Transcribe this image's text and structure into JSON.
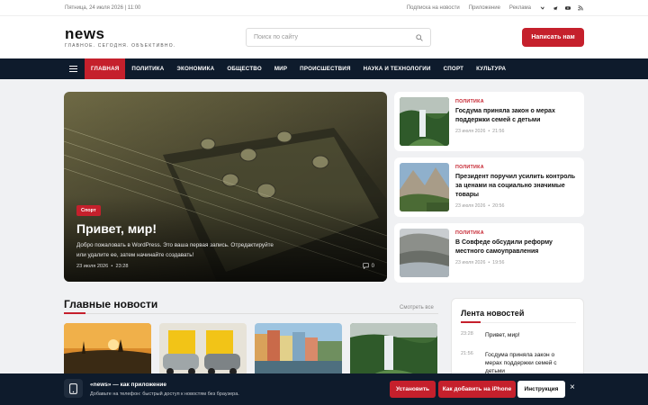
{
  "topbar": {
    "date": "Пятница, 24 июля 2026 | 11:00",
    "links": [
      "Подписка на новости",
      "Приложение",
      "Реклама"
    ],
    "social": [
      "vk-icon",
      "telegram-icon",
      "youtube-icon",
      "rss-icon"
    ]
  },
  "header": {
    "logo": "news",
    "tagline": "ГЛАВНОЕ. СЕГОДНЯ. ОБЪЕКТИВНО.",
    "search_placeholder": "Поиск по сайту",
    "write_button": "Написать нам"
  },
  "nav": {
    "items": [
      "ГЛАВНАЯ",
      "ПОЛИТИКА",
      "ЭКОНОМИКА",
      "ОБЩЕСТВО",
      "МИР",
      "ПРОИСШЕСТВИЯ",
      "НАУКА И ТЕХНОЛОГИИ",
      "СПОРТ",
      "КУЛЬТУРА"
    ],
    "active_index": 0
  },
  "hero": {
    "label": "Спорт",
    "title": "Привет, мир!",
    "excerpt": "Добро пожаловать в WordPress. Это ваша первая запись. Отредактируйте или удалите ее, затем начинайте создавать!",
    "date": "23 июля 2026",
    "time": "23:28",
    "comments": "0"
  },
  "side_news": [
    {
      "category": "ПОЛИТИКА",
      "title": "Госдума приняла закон о мерах поддержки семей с детьми",
      "date": "23 июля 2026",
      "time": "21:56"
    },
    {
      "category": "ПОЛИТИКА",
      "title": "Президент поручил усилить контроль за ценами на социально значимые товары",
      "date": "23 июля 2026",
      "time": "20:56"
    },
    {
      "category": "ПОЛИТИКА",
      "title": "В Совфеде обсудили реформу местного самоуправления",
      "date": "23 июля 2026",
      "time": "19:56"
    }
  ],
  "main_news": {
    "title": "Главные новости",
    "see_all": "Смотреть все"
  },
  "feed": {
    "title": "Лента новостей",
    "items": [
      {
        "time": "23:28",
        "text": "Привет, мир!"
      },
      {
        "time": "21:56",
        "text": "Госдума приняла закон о мерах поддержки семей с детьми"
      }
    ]
  },
  "banner": {
    "title": "«news» — как приложение",
    "subtitle": "Добавьте на телефон: быстрый доступ к новостям без браузера.",
    "install": "Установить",
    "iphone": "Как добавить на iPhone",
    "instructions": "Инструкция",
    "close": "×"
  },
  "colors": {
    "accent": "#c5202c",
    "navy": "#0e1b2c"
  }
}
